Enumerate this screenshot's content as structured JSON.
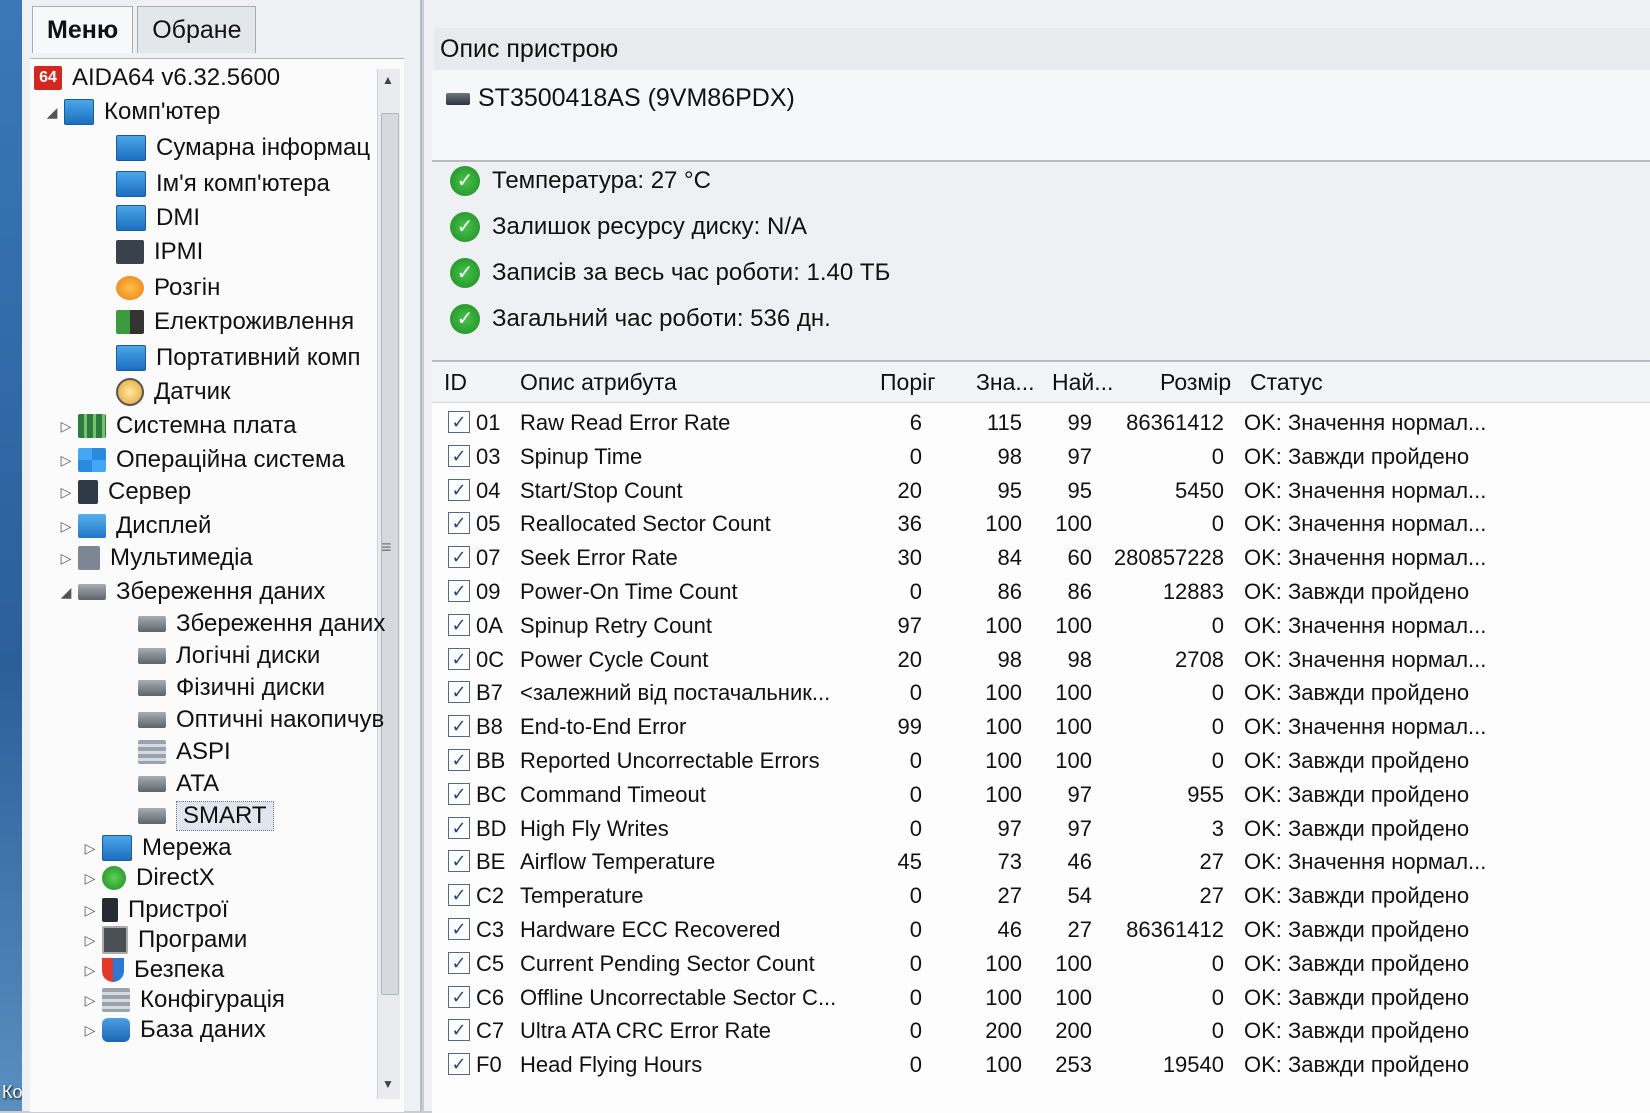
{
  "tabs": [
    "Меню",
    "Обране"
  ],
  "tree": {
    "root": "AIDA64 v6.32.5600",
    "root_icon_text": "64",
    "items": [
      {
        "label": "Комп'ютер",
        "icon": "monitor-icon"
      },
      {
        "label": "Сумарна інформац",
        "icon": "monitor-icon"
      },
      {
        "label": "Ім'я комп'ютера",
        "icon": "monitor-icon"
      },
      {
        "label": "DMI",
        "icon": "monitor-icon"
      },
      {
        "label": "IPMI",
        "icon": "server-icon"
      },
      {
        "label": "Розгін",
        "icon": "flame-icon"
      },
      {
        "label": "Електроживлення",
        "icon": "battery-icon"
      },
      {
        "label": "Портативний комп",
        "icon": "laptop-icon"
      },
      {
        "label": "Датчик",
        "icon": "gauge-icon"
      },
      {
        "label": "Системна плата",
        "icon": "motherboard-icon"
      },
      {
        "label": "Операційна система",
        "icon": "windows-icon"
      },
      {
        "label": "Сервер",
        "icon": "server-icon"
      },
      {
        "label": "Дисплей",
        "icon": "display-icon"
      },
      {
        "label": "Мультимедіа",
        "icon": "speaker-icon"
      },
      {
        "label": "Збереження даних",
        "icon": "storage-icon"
      },
      {
        "label": "Збереження даних",
        "icon": "storage-icon"
      },
      {
        "label": "Логічні диски",
        "icon": "disk-icon"
      },
      {
        "label": "Фізичні диски",
        "icon": "disk-icon"
      },
      {
        "label": "Оптичні накопичув",
        "icon": "optical-drive-icon"
      },
      {
        "label": "ASPI",
        "icon": "aspi-icon"
      },
      {
        "label": "ATA",
        "icon": "disk-icon"
      },
      {
        "label": "SMART",
        "icon": "disk-icon"
      },
      {
        "label": "Мережа",
        "icon": "network-icon"
      },
      {
        "label": "DirectX",
        "icon": "xbox-icon"
      },
      {
        "label": "Пристрої",
        "icon": "device-icon"
      },
      {
        "label": "Програми",
        "icon": "programs-icon"
      },
      {
        "label": "Безпека",
        "icon": "shield-icon"
      },
      {
        "label": "Конфігурація",
        "icon": "config-icon"
      },
      {
        "label": "База даних",
        "icon": "database-icon"
      }
    ]
  },
  "desktop_label": "Корз",
  "right": {
    "desc_header": "Опис пристрою",
    "device_name": "ST3500418AS (9VM86PDX)",
    "status": [
      "Температура: 27 °C",
      "Залишок ресурсу диску: N/A",
      "Записів за весь час роботи: 1.40 ТБ",
      "Загальний час роботи: 536 дн."
    ]
  },
  "table": {
    "columns": [
      "ID",
      "Опис атрибута",
      "Поріг",
      "Зна...",
      "Най...",
      "Розмір",
      "Статус"
    ],
    "check_mark": "✓",
    "rows": [
      {
        "id": "01",
        "desc": "Raw Read Error Rate",
        "thr": "6",
        "val": "115",
        "worst": "99",
        "raw": "86361412",
        "status": "OK: Значення нормал..."
      },
      {
        "id": "03",
        "desc": "Spinup Time",
        "thr": "0",
        "val": "98",
        "worst": "97",
        "raw": "0",
        "status": "OK: Завжди пройдено"
      },
      {
        "id": "04",
        "desc": "Start/Stop Count",
        "thr": "20",
        "val": "95",
        "worst": "95",
        "raw": "5450",
        "status": "OK: Значення нормал..."
      },
      {
        "id": "05",
        "desc": "Reallocated Sector Count",
        "thr": "36",
        "val": "100",
        "worst": "100",
        "raw": "0",
        "status": "OK: Значення нормал..."
      },
      {
        "id": "07",
        "desc": "Seek Error Rate",
        "thr": "30",
        "val": "84",
        "worst": "60",
        "raw": "280857228",
        "status": "OK: Значення нормал..."
      },
      {
        "id": "09",
        "desc": "Power-On Time Count",
        "thr": "0",
        "val": "86",
        "worst": "86",
        "raw": "12883",
        "status": "OK: Завжди пройдено"
      },
      {
        "id": "0A",
        "desc": "Spinup Retry Count",
        "thr": "97",
        "val": "100",
        "worst": "100",
        "raw": "0",
        "status": "OK: Значення нормал..."
      },
      {
        "id": "0C",
        "desc": "Power Cycle Count",
        "thr": "20",
        "val": "98",
        "worst": "98",
        "raw": "2708",
        "status": "OK: Значення нормал..."
      },
      {
        "id": "B7",
        "desc": "<залежний від постачальник...",
        "thr": "0",
        "val": "100",
        "worst": "100",
        "raw": "0",
        "status": "OK: Завжди пройдено"
      },
      {
        "id": "B8",
        "desc": "End-to-End Error",
        "thr": "99",
        "val": "100",
        "worst": "100",
        "raw": "0",
        "status": "OK: Значення нормал..."
      },
      {
        "id": "BB",
        "desc": "Reported Uncorrectable Errors",
        "thr": "0",
        "val": "100",
        "worst": "100",
        "raw": "0",
        "status": "OK: Завжди пройдено"
      },
      {
        "id": "BC",
        "desc": "Command Timeout",
        "thr": "0",
        "val": "100",
        "worst": "97",
        "raw": "955",
        "status": "OK: Завжди пройдено"
      },
      {
        "id": "BD",
        "desc": "High Fly Writes",
        "thr": "0",
        "val": "97",
        "worst": "97",
        "raw": "3",
        "status": "OK: Завжди пройдено"
      },
      {
        "id": "BE",
        "desc": "Airflow Temperature",
        "thr": "45",
        "val": "73",
        "worst": "46",
        "raw": "27",
        "status": "OK: Значення нормал..."
      },
      {
        "id": "C2",
        "desc": "Temperature",
        "thr": "0",
        "val": "27",
        "worst": "54",
        "raw": "27",
        "status": "OK: Завжди пройдено"
      },
      {
        "id": "C3",
        "desc": "Hardware ECC Recovered",
        "thr": "0",
        "val": "46",
        "worst": "27",
        "raw": "86361412",
        "status": "OK: Завжди пройдено"
      },
      {
        "id": "C5",
        "desc": "Current Pending Sector Count",
        "thr": "0",
        "val": "100",
        "worst": "100",
        "raw": "0",
        "status": "OK: Завжди пройдено"
      },
      {
        "id": "C6",
        "desc": "Offline Uncorrectable Sector C...",
        "thr": "0",
        "val": "100",
        "worst": "100",
        "raw": "0",
        "status": "OK: Завжди пройдено"
      },
      {
        "id": "C7",
        "desc": "Ultra ATA CRC Error Rate",
        "thr": "0",
        "val": "200",
        "worst": "200",
        "raw": "0",
        "status": "OK: Завжди пройдено"
      },
      {
        "id": "F0",
        "desc": "Head Flying Hours",
        "thr": "0",
        "val": "100",
        "worst": "253",
        "raw": "19540",
        "status": "OK: Завжди пройдено"
      }
    ]
  }
}
